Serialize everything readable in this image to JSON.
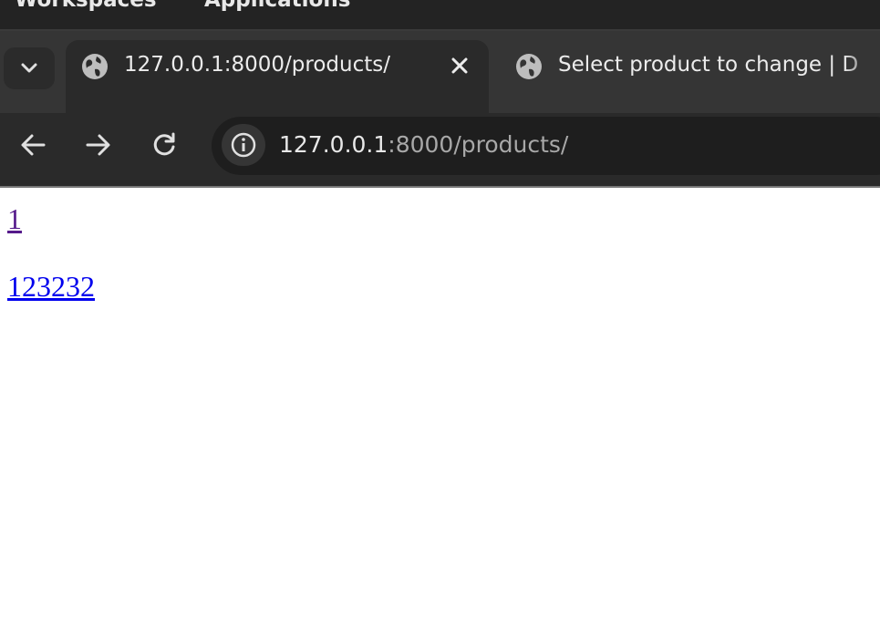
{
  "desktop": {
    "menu": [
      "Workspaces",
      "Applications"
    ]
  },
  "browser": {
    "tabs": [
      {
        "title": "127.0.0.1:8000/products/",
        "active": true,
        "icon": "globe-icon"
      },
      {
        "title": "Select product to change | D",
        "active": false,
        "icon": "globe-icon"
      }
    ],
    "address": {
      "host": "127.0.0.1",
      "rest": ":8000/products/"
    }
  },
  "page": {
    "links": [
      "1",
      "123232"
    ]
  },
  "colors": {
    "visited_link": "#551a8b",
    "link": "#0000ee",
    "chrome_dark": "#2a2a2a"
  }
}
